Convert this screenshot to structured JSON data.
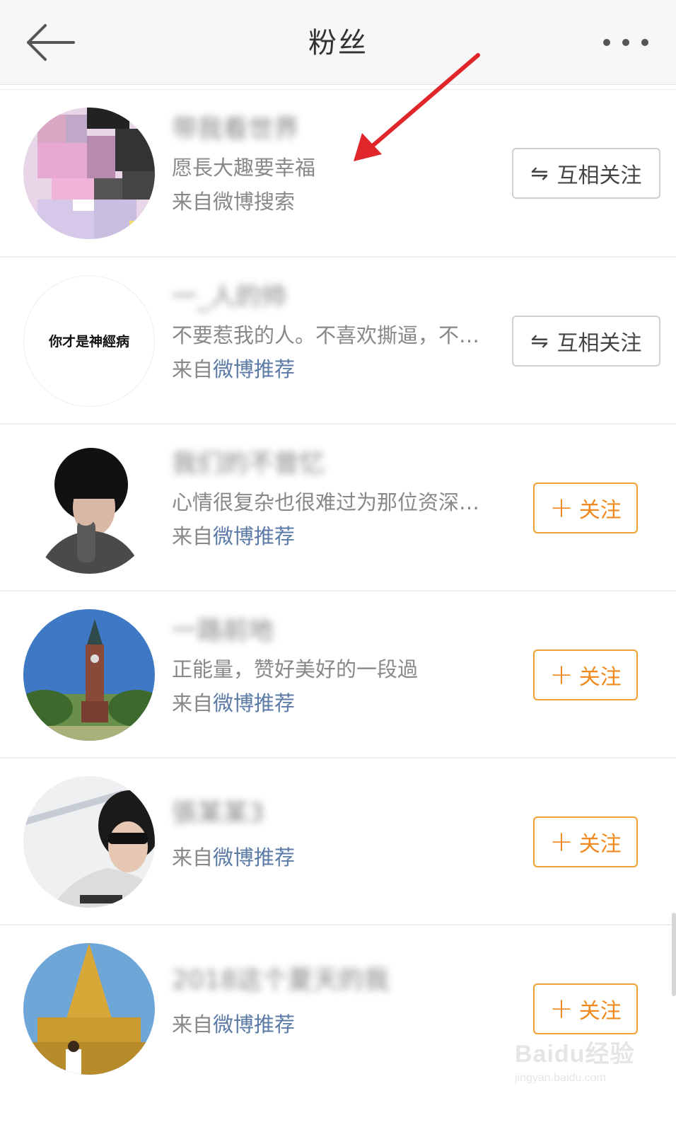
{
  "header": {
    "title": "粉丝"
  },
  "fans": [
    {
      "name": "带我看世界",
      "desc": "愿長大趣要幸福",
      "source_prefix": "来自",
      "source_link": "微博搜索",
      "button": "互相关注",
      "button_type": "mutual",
      "avatar": "pixelated-photo"
    },
    {
      "name": "一_人的帅",
      "desc": "不要惹我的人。不喜欢撕逼，不喜欢被人利用",
      "source_prefix": "来自",
      "source_link": "微博推荐",
      "button": "互相关注",
      "button_type": "mutual",
      "avatar": "text-logo",
      "avatar_text": "你才是神經病"
    },
    {
      "name": "我们的不曾忆",
      "desc": "心情很复杂也很难过为那位资深的朋友",
      "source_prefix": "来自",
      "source_link": "微博推荐",
      "button": "关注",
      "button_type": "follow",
      "avatar": "boy-portrait"
    },
    {
      "name": "一路前地",
      "desc": "正能量，赞好美好的一段過",
      "source_prefix": "来自",
      "source_link": "微博推荐",
      "button": "关注",
      "button_type": "follow",
      "avatar": "clock-tower"
    },
    {
      "name": "張某某3",
      "desc": "",
      "source_prefix": "来自",
      "source_link": "微博推荐",
      "button": "关注",
      "button_type": "follow",
      "avatar": "sunglasses-boy"
    },
    {
      "name": "2018这个夏天的我",
      "desc": "",
      "source_prefix": "来自",
      "source_link": "微博推荐",
      "button": "关注",
      "button_type": "follow",
      "avatar": "golden-pagoda"
    }
  ],
  "watermark": {
    "brand": "Baidu经验",
    "url": "jingyan.baidu.com"
  },
  "icons": {
    "back": "back-arrow-icon",
    "more": "more-dots-icon",
    "mutual": "swap-arrows-icon",
    "follow": "plus-icon"
  },
  "colors": {
    "follow_accent": "#f08a1e",
    "link": "#5b7aa6",
    "annotation_arrow": "#e0262b"
  }
}
